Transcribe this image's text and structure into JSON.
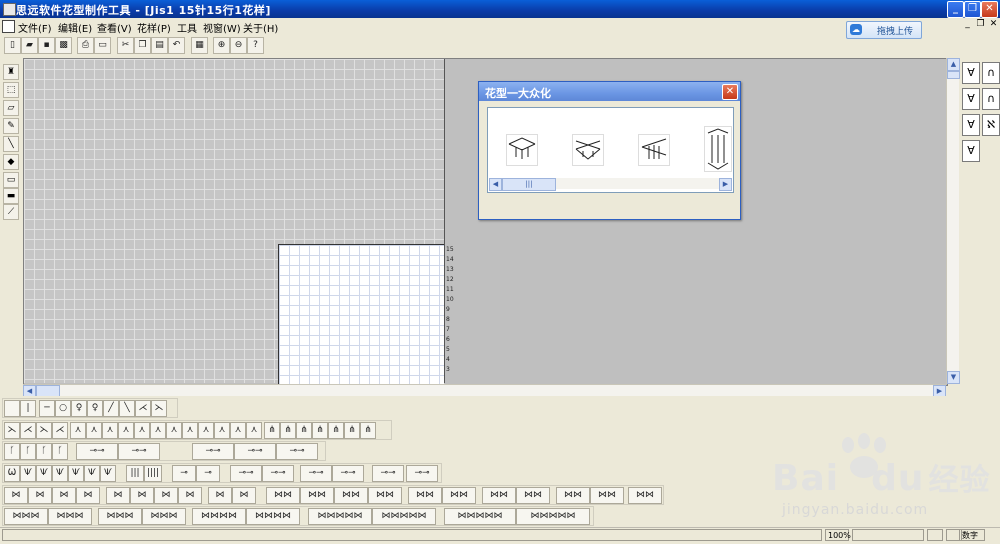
{
  "window": {
    "title": "思远软件花型制作工具 - [Jis1 15针15行1花样]"
  },
  "menubar": {
    "items": [
      {
        "label": "文件(F)"
      },
      {
        "label": "编辑(E)"
      },
      {
        "label": "查看(V)"
      },
      {
        "label": "花样(P)"
      },
      {
        "label": "工具"
      },
      {
        "label": "视窗(W)"
      },
      {
        "label": "关于(H)"
      }
    ]
  },
  "upload_button": {
    "label": "拖拽上传"
  },
  "grid": {
    "stitches": 15,
    "rows": 15,
    "row_numbers": [
      "15",
      "14",
      "13",
      "12",
      "11",
      "10",
      "9",
      "8",
      "7",
      "6",
      "5",
      "4",
      "3"
    ]
  },
  "dialog": {
    "title": "花型一大众化",
    "scroll_thumb": "|||"
  },
  "statusbar": {
    "zoom": "100%",
    "mode": "数字"
  },
  "watermark": {
    "brand": "Bai",
    "brand2": "du",
    "brand3": "经验",
    "url": "jingyan.baidu.com"
  },
  "colors": {
    "title_bar": "#0a3ba8",
    "dialog_title": "#6b96e4",
    "workspace": "#bfbfbf",
    "grid_gray": "#c6c6c6",
    "grid_white": "#ffffff"
  }
}
